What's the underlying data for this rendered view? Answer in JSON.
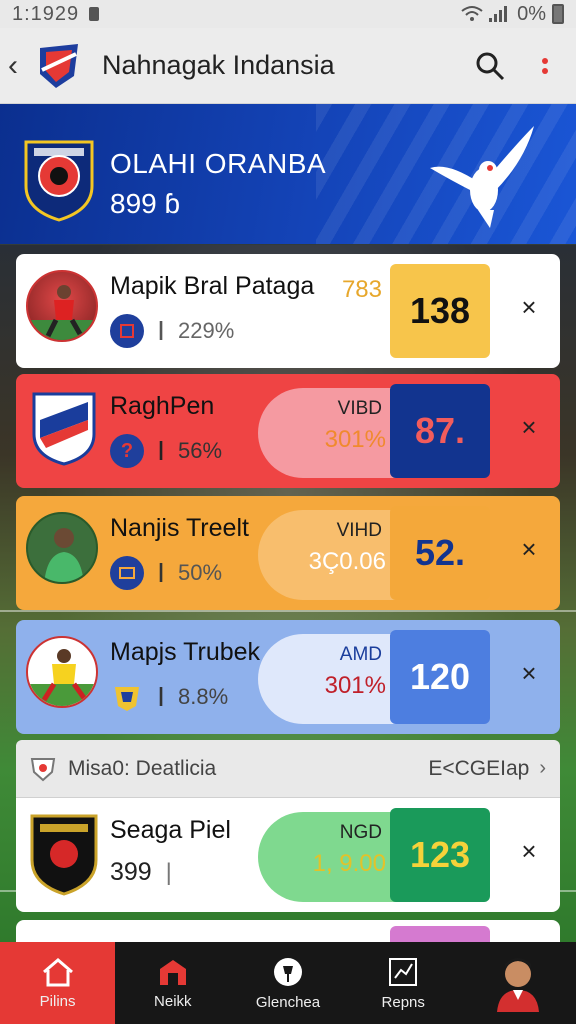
{
  "status": {
    "time": "1:1929",
    "battery": "0%"
  },
  "appbar": {
    "title": "Nahnagak Indansia"
  },
  "hero": {
    "team_name": "OLAHI ORANBA",
    "sub": "899 ɓ"
  },
  "cards": [
    {
      "name": "Mapik Bral Pataga",
      "pct": "229%",
      "pill_label": "783",
      "pill_value": "",
      "score": "138"
    },
    {
      "name": "RaghPen",
      "pct": "56%",
      "pill_label": "VIBD",
      "pill_value": "301%",
      "score": "87."
    },
    {
      "name": "Nanjis Treelt",
      "pct": "50%",
      "pill_label": "VIHD",
      "pill_value": "3Ç0.06",
      "score": "52."
    },
    {
      "name": "Mapjs Trubek",
      "pct": "8.8%",
      "pill_label": "AMD",
      "pill_value": "301%",
      "score": "120"
    },
    {
      "name": "Seaga Piel",
      "pct": "399",
      "pill_label": "NGD",
      "pill_value": "1, 9.00",
      "score": "123"
    }
  ],
  "section": {
    "title": "Misa0: Deatlicia",
    "link": "E<CGEIap"
  },
  "nav": [
    {
      "label": "Pilins",
      "icon": "home-icon"
    },
    {
      "label": "Neikk",
      "icon": "store-icon"
    },
    {
      "label": "Glenchea",
      "icon": "trophy-icon"
    },
    {
      "label": "Repns",
      "icon": "chart-icon"
    },
    {
      "label": "",
      "icon": "profile-avatar"
    }
  ],
  "colors": {
    "hero": "#1444b8",
    "card1": "#ffffff",
    "card2": "#ef4444",
    "card3": "#f5a83c",
    "card4": "#8fb1ec",
    "card5": "#ffffff",
    "nav_active": "#e53935"
  }
}
